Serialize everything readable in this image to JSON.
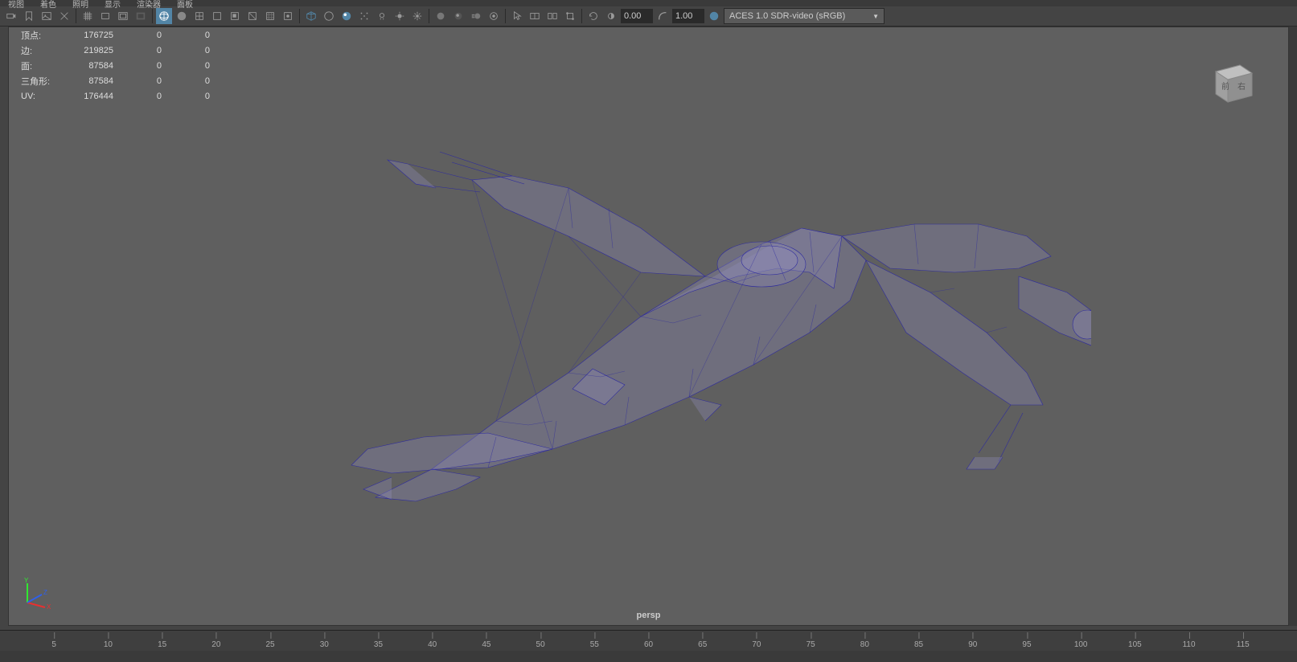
{
  "menu": {
    "items": [
      "视图",
      "着色",
      "照明",
      "显示",
      "渲染器",
      "面板"
    ]
  },
  "toolbar": {
    "num1": "0.00",
    "num2": "1.00",
    "colorspace": "ACES 1.0 SDR-video (sRGB)",
    "icons": [
      "select-camera-icon",
      "bookmark-icon",
      "image-plane-icon",
      "grid-toggle-icon",
      "film-gate-icon",
      "resolution-gate-icon",
      "gate-mask-icon",
      "field-chart-icon",
      "wireframe-icon",
      "smooth-shade-icon",
      "textured-icon",
      "use-lights-icon",
      "shadows-icon",
      "isolate-icon",
      "xray-icon",
      "xray-joints-icon",
      "cube-icon",
      "sphere-toggle-icon",
      "sphere-highlight-icon",
      "dots-icon",
      "light-on-icon",
      "light-flat-icon",
      "light-full-icon",
      "sphere-icon",
      "ao-icon",
      "motion-blur-icon",
      "depth-icon",
      "cursor-icon",
      "view-icon",
      "transform-icon",
      "snap-icon",
      "refresh-icon",
      "exposure-icon",
      "gamma-icon",
      "color-manage-icon"
    ]
  },
  "stats": {
    "rows": [
      {
        "label": "顶点:",
        "v1": "176725",
        "v2": "0",
        "v3": "0"
      },
      {
        "label": "边:",
        "v1": "219825",
        "v2": "0",
        "v3": "0"
      },
      {
        "label": "面:",
        "v1": "87584",
        "v2": "0",
        "v3": "0"
      },
      {
        "label": "三角形:",
        "v1": "87584",
        "v2": "0",
        "v3": "0"
      },
      {
        "label": "UV:",
        "v1": "176444",
        "v2": "0",
        "v3": "0"
      }
    ]
  },
  "viewport": {
    "camera": "persp",
    "cube_faces": {
      "front": "前",
      "right": "右"
    }
  },
  "timeline": {
    "ticks": [
      5,
      10,
      15,
      20,
      25,
      30,
      35,
      40,
      45,
      50,
      55,
      60,
      65,
      70,
      75,
      80,
      85,
      90,
      95,
      100,
      105,
      110,
      115
    ]
  },
  "colors": {
    "wireframe": "#2d2a9e",
    "axis_x": "#e83030",
    "axis_y": "#30e830",
    "axis_z": "#3060e8"
  }
}
